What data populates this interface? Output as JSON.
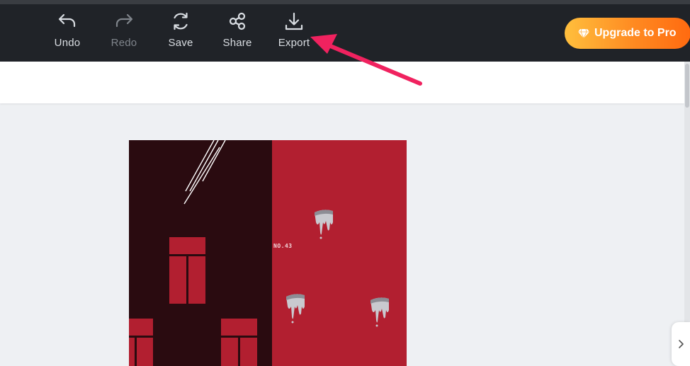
{
  "toolbar": {
    "undo_label": "Undo",
    "redo_label": "Redo",
    "save_label": "Save",
    "share_label": "Share",
    "export_label": "Export",
    "upgrade_label": "Upgrade to Pro"
  },
  "canvas": {
    "text_no": "NO.43"
  },
  "colors": {
    "toolbar_bg": "#202328",
    "upgrade_start": "#ffbf3d",
    "upgrade_end": "#ff6a10",
    "annotation_arrow": "#f0225f",
    "canvas_red": "#b21f30",
    "canvas_dark": "#2a0b10"
  },
  "icons": [
    "undo-icon",
    "redo-icon",
    "save-icon",
    "share-icon",
    "export-icon",
    "diamond-icon",
    "chevron-right-icon"
  ]
}
